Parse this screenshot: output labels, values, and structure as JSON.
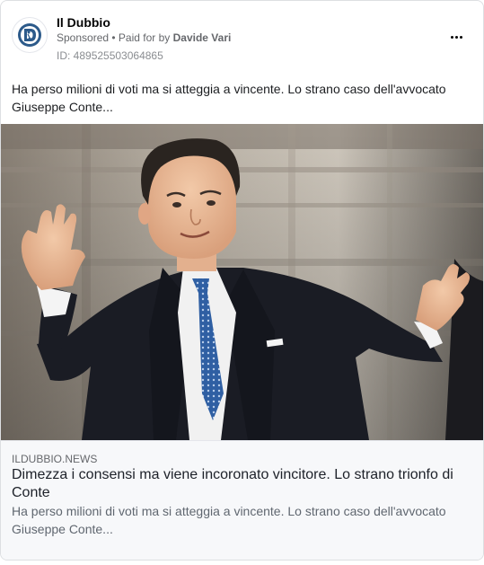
{
  "post": {
    "page_name": "Il Dubbio",
    "sponsored_label": "Sponsored",
    "separator": " • ",
    "paid_for_label": "Paid for by ",
    "payer": "Davide Vari",
    "id_label": "ID: 489525503064865",
    "body_text": "Ha perso milioni di voti ma si atteggia a vincente. Lo strano caso dell'avvocato Giuseppe Conte..."
  },
  "link": {
    "domain": "ILDUBBIO.NEWS",
    "title": "Dimezza i consensi ma viene incoronato vincitore. Lo strano trionfo di Conte",
    "description": "Ha perso milioni di voti ma si atteggia a vincente. Lo strano caso dell'avvocato Giuseppe Conte..."
  },
  "icons": {
    "avatar": "il-dubbio-logo-icon",
    "more": "more-options-icon"
  },
  "colors": {
    "logo_blue": "#2c5a8a",
    "secondary_text": "#65676b",
    "link_background": "#f7f8fa"
  }
}
